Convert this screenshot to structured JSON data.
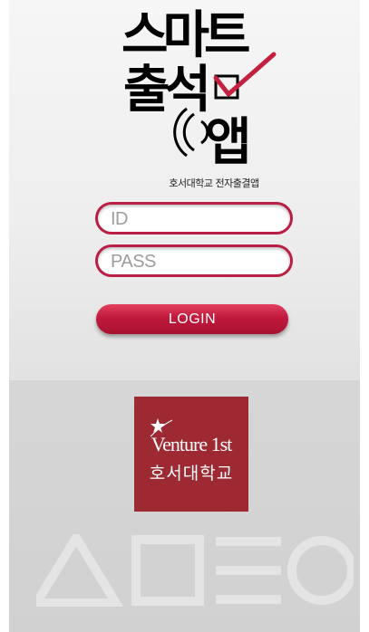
{
  "app": {
    "logo_lines": [
      "스마트",
      "출석",
      "앱"
    ],
    "subtitle": "호서대학교 전자출결앱"
  },
  "login": {
    "id_placeholder": "ID",
    "pass_placeholder": "PASS",
    "button_label": "LOGIN"
  },
  "sponsor": {
    "english": "Venture 1st",
    "korean": "호서대학교"
  },
  "colors": {
    "accent": "#b91f45",
    "sponsor_bg": "#9d2932",
    "logo_black": "#000000"
  },
  "icons": [
    "checkbox-check-icon",
    "signal-waves-icon",
    "triangle-icon",
    "square-icon",
    "menu-lines-icon",
    "circle-icon"
  ]
}
